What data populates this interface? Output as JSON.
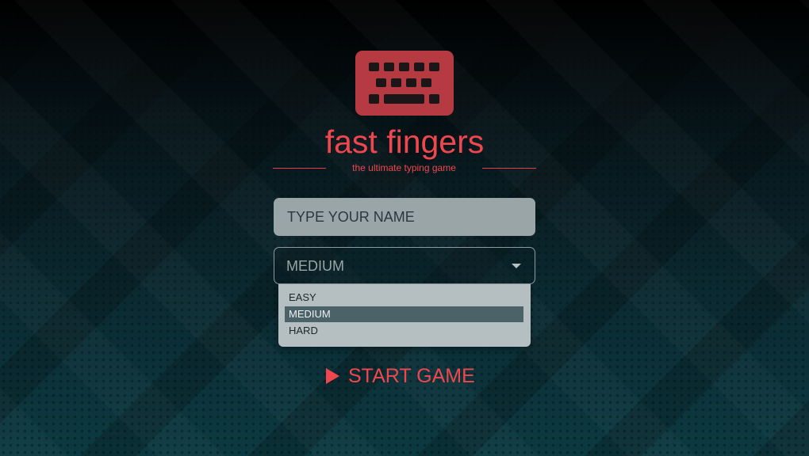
{
  "app": {
    "title": "fast fingers",
    "tagline": "the ultimate typing game",
    "logo_icon": "keyboard-icon"
  },
  "form": {
    "name_placeholder": "TYPE YOUR NAME",
    "name_value": "",
    "difficulty": {
      "selected": "MEDIUM",
      "expanded": true,
      "options": [
        "EASY",
        "MEDIUM",
        "HARD"
      ]
    }
  },
  "start": {
    "label": "START GAME",
    "icon": "play-icon"
  },
  "colors": {
    "accent": "#f0474f",
    "logo_bg": "#b63a42",
    "input_bg": "#9aa5a8",
    "option_highlight": "#4b6269"
  }
}
